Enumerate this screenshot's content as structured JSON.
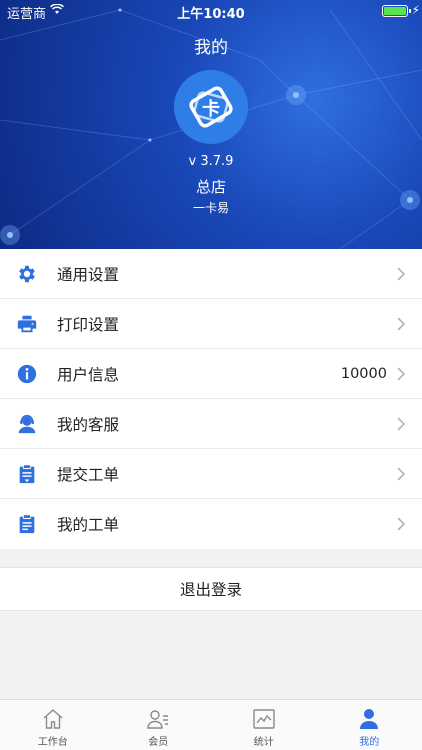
{
  "status_bar": {
    "carrier": "运营商",
    "time": "上午10:40"
  },
  "header": {
    "title": "我的",
    "version": "v 3.7.9",
    "store_name": "总店",
    "brand": "一卡易"
  },
  "menu": [
    {
      "label": "通用设置",
      "value": "",
      "icon": "gear-icon"
    },
    {
      "label": "打印设置",
      "value": "",
      "icon": "printer-icon"
    },
    {
      "label": "用户信息",
      "value": "10000",
      "icon": "info-icon"
    },
    {
      "label": "我的客服",
      "value": "",
      "icon": "customer-service-icon"
    },
    {
      "label": "提交工单",
      "value": "",
      "icon": "submit-ticket-icon"
    },
    {
      "label": "我的工单",
      "value": "",
      "icon": "ticket-icon"
    }
  ],
  "logout_label": "退出登录",
  "tabs": [
    {
      "label": "工作台",
      "icon": "home-icon",
      "active": false
    },
    {
      "label": "会员",
      "icon": "members-icon",
      "active": false
    },
    {
      "label": "统计",
      "icon": "stats-icon",
      "active": false
    },
    {
      "label": "我的",
      "icon": "profile-icon",
      "active": true
    }
  ],
  "colors": {
    "accent": "#2f6fe0",
    "header_dark": "#0d2a85",
    "icon_blue": "#2f6fe0"
  }
}
